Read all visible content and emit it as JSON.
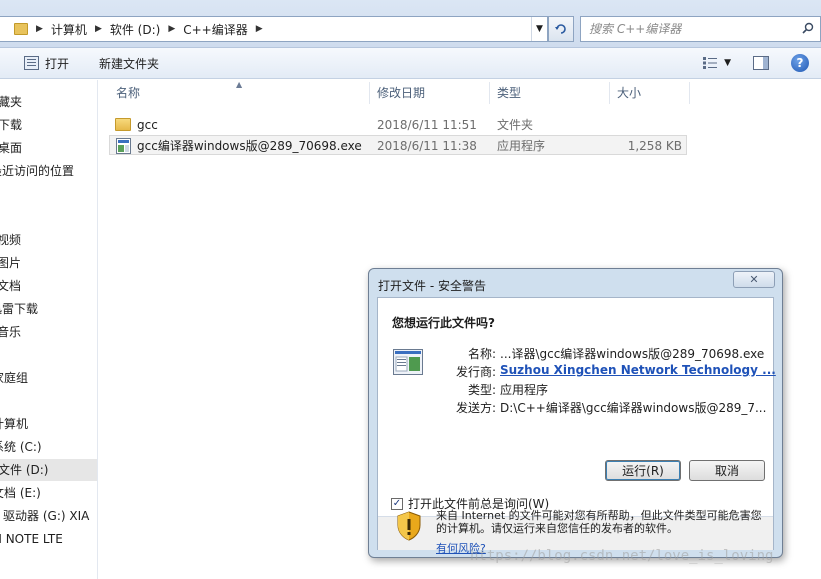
{
  "address": {
    "breadcrumbs": [
      "计算机",
      "软件 (D:)",
      "C++编译器"
    ],
    "search_placeholder": "搜索 C++编译器"
  },
  "toolbar": {
    "open_label": "打开",
    "new_folder_label": "新建文件夹"
  },
  "nav": {
    "items": [
      "藏夹",
      "下载",
      "桌面",
      "最近访问的位置",
      "视频",
      "图片",
      "文档",
      "迅雷下载",
      "音乐",
      "家庭组",
      "计算机",
      "系统 (C:)",
      "文件 (D:)",
      "文档 (E:)",
      "D 驱动器 (G:) XIA",
      "MI NOTE LTE"
    ],
    "selected": "文件 (D:)"
  },
  "list": {
    "columns": [
      "名称",
      "修改日期",
      "类型",
      "大小"
    ],
    "rows": [
      {
        "name": "gcc",
        "date": "2018/6/11 11:51",
        "type": "文件夹",
        "size": "",
        "icon": "folder-icon"
      },
      {
        "name": "gcc编译器windows版@289_70698.exe",
        "date": "2018/6/11 11:38",
        "type": "应用程序",
        "size": "1,258 KB",
        "icon": "exe-icon"
      }
    ]
  },
  "dialog": {
    "title": "打开文件 - 安全警告",
    "question": "您想运行此文件吗?",
    "fields": [
      {
        "label": "名称:",
        "value": "...译器\\gcc编译器windows版@289_70698.exe"
      },
      {
        "label": "发行商:",
        "value": "Suzhou Xingchen Network Technology ..."
      },
      {
        "label": "类型:",
        "value": "应用程序"
      },
      {
        "label": "发送方:",
        "value": "D:\\C++编译器\\gcc编译器windows版@289_7..."
      }
    ],
    "run_label": "运行(R)",
    "cancel_label": "取消",
    "checkbox_label": "打开此文件前总是询问(W)",
    "checkbox_checked": true,
    "warning_text": "来自 Internet 的文件可能对您有所帮助，但此文件类型可能危害您的计算机。请仅运行来自您信任的发布者的软件。",
    "risk_link": "有何风险?"
  },
  "watermark": "https://blog.csdn.net/love_is_loving"
}
